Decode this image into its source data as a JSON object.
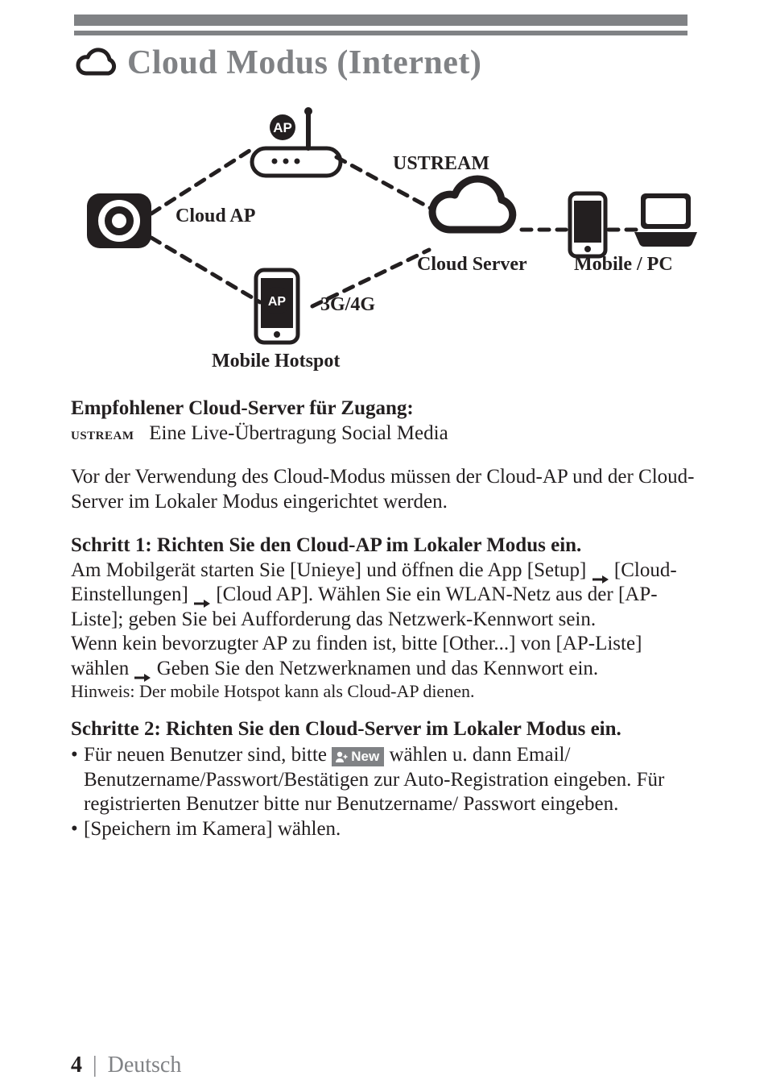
{
  "title": "Cloud Modus (Internet)",
  "diagram": {
    "ustream": "USTREAM",
    "cloud_ap": "Cloud AP",
    "cloud_server": "Cloud Server",
    "mobile_pc": "Mobile / PC",
    "three_four_g": "3G/4G",
    "mobile_hotspot": "Mobile Hotspot",
    "ap_badge": "AP"
  },
  "rec_heading": "Empfohlener Cloud-Server für Zugang:",
  "rec_brand": "ustream",
  "rec_desc": "Eine Live-Übertragung Social Media",
  "intro": "Vor der Verwendung des Cloud-Modus müssen der Cloud-AP und der Cloud-Server im Lokaler Modus eingerichtet werden.",
  "step1_heading": "Schritt 1: Richten Sie den Cloud-AP im Lokaler Modus ein.",
  "step1_line1_a": "Am Mobilgerät starten Sie [Unieye] und öffnen die App [Setup]",
  "step1_line1_b": "[Cloud-Einstellungen]",
  "step1_line1_c": "[Cloud AP]. Wählen Sie ein WLAN-Netz aus der [AP-Liste]; geben Sie bei Aufforderung das Netzwerk-Kennwort sein.",
  "step1_line2_a": "Wenn kein bevorzugter AP zu finden ist,  bitte [Other...] von [AP-Liste] wählen",
  "step1_line2_b": "Geben Sie den Netzwerknamen und das Kennwort ein.",
  "step1_note": "Hinweis: Der mobile Hotspot kann als Cloud-AP dienen.",
  "step2_heading": "Schritte 2: Richten Sie den Cloud-Server im Lokaler Modus ein.",
  "step2_b1_a": "Für neuen Benutzer sind, bitte ",
  "step2_b1_new": "New",
  "step2_b1_b": " wählen u. dann Email/ Benutzername/Passwort/Bestätigen zur Auto-Registration eingeben. Für registrierten Benutzer bitte nur Benutzername/ Passwort eingeben.",
  "step2_b2": "[Speichern im Kamera] wählen.",
  "footer": {
    "page": "4",
    "sep": "|",
    "lang": "Deutsch"
  }
}
